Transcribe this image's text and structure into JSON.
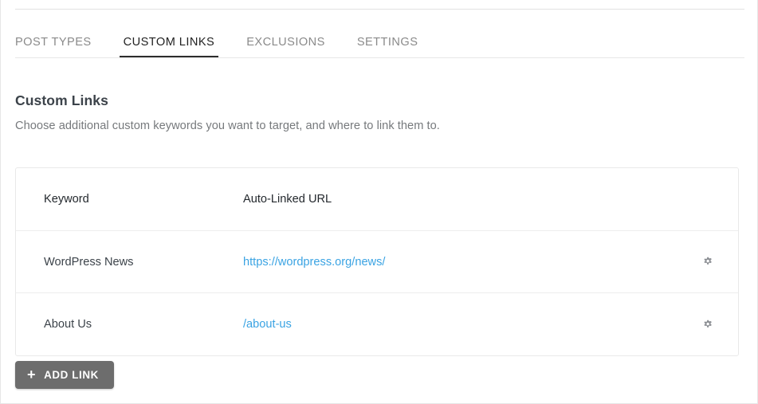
{
  "tabs": [
    {
      "label": "POST TYPES",
      "active": false
    },
    {
      "label": "CUSTOM LINKS",
      "active": true
    },
    {
      "label": "EXCLUSIONS",
      "active": false
    },
    {
      "label": "SETTINGS",
      "active": false
    }
  ],
  "section": {
    "title": "Custom Links",
    "description": "Choose additional custom keywords you want to target, and where to link them to."
  },
  "table": {
    "columns": {
      "keyword": "Keyword",
      "url": "Auto-Linked URL"
    },
    "rows": [
      {
        "keyword": "WordPress News",
        "url_text": "https://wordpress.org/news/",
        "action_icon": "gear-icon"
      },
      {
        "keyword": "About Us",
        "url_text": "/about-us",
        "action_icon": "gear-icon"
      }
    ]
  },
  "add_button": {
    "icon": "plus-icon",
    "plus": "+",
    "label": "ADD LINK"
  },
  "colors": {
    "link": "#3aa3e3",
    "active_tab_underline": "#2d2d2d",
    "button_bg": "#6d6d6d",
    "heading_text": "#3c434a",
    "muted_text": "#76797c"
  }
}
